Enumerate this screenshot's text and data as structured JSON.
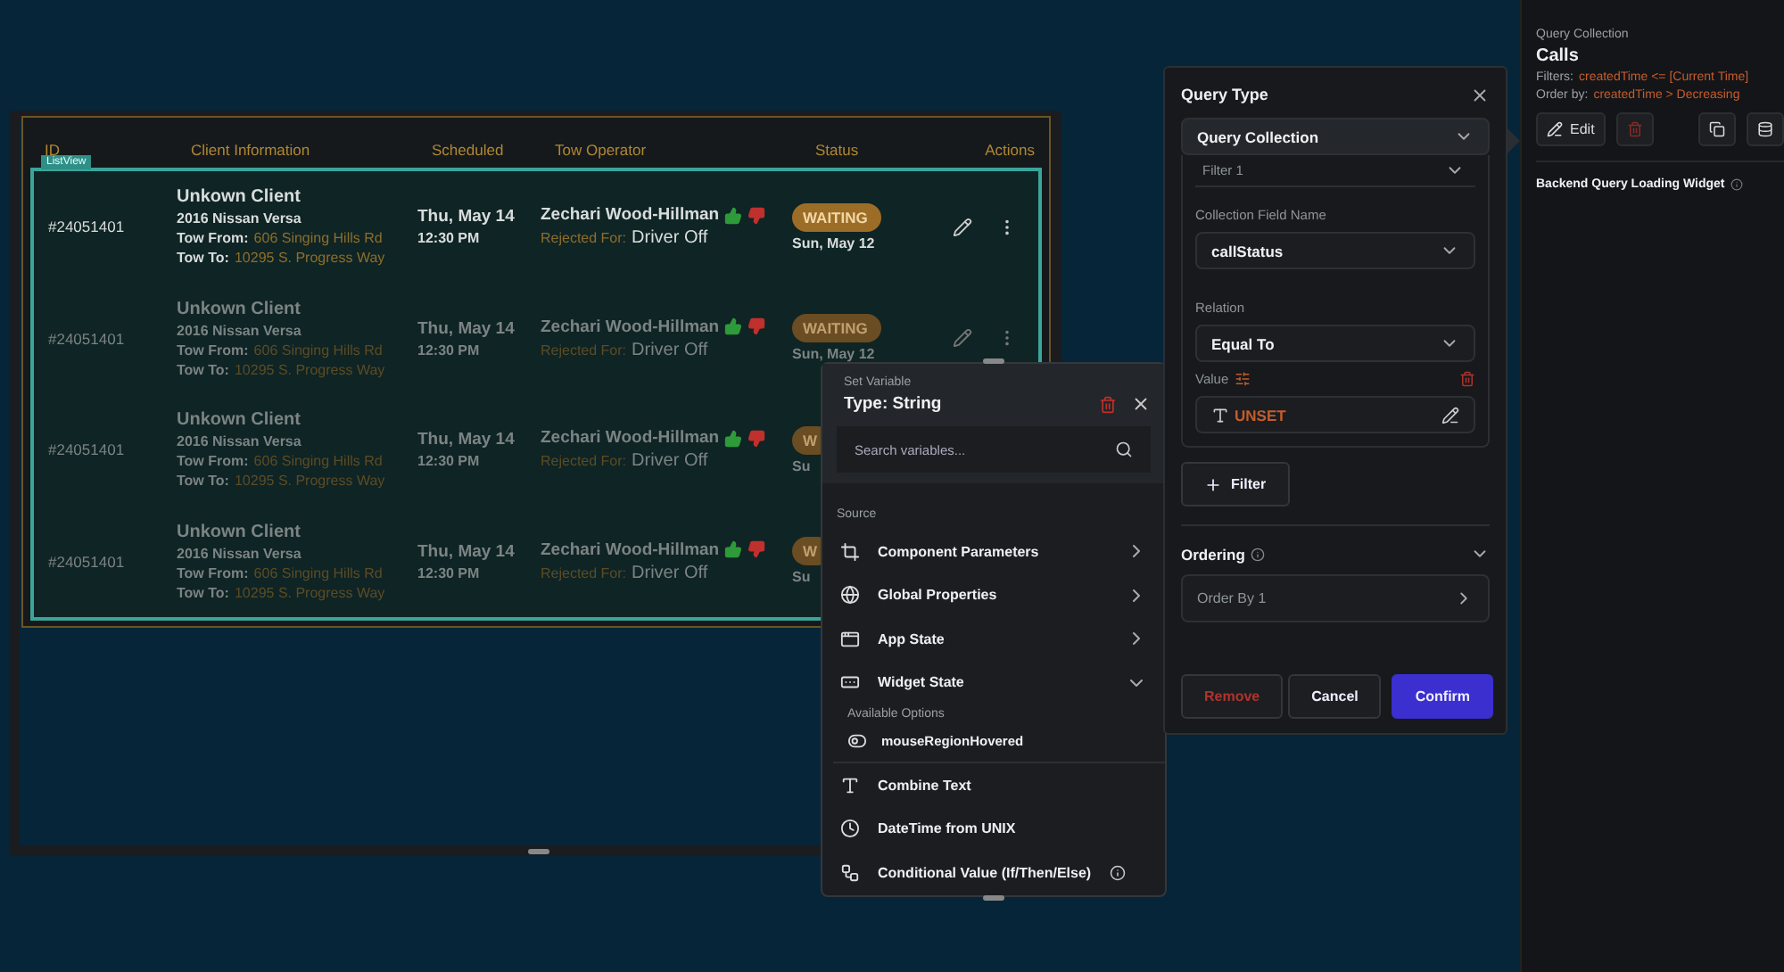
{
  "table": {
    "list_tag": "ListView",
    "columns": [
      "ID",
      "Client Information",
      "Scheduled",
      "Tow Operator",
      "Status",
      "Actions"
    ],
    "rows": [
      {
        "id": "#24051401",
        "client": "Unkown Client",
        "vehicle": "2016 Nissan Versa",
        "from_label": "Tow From:",
        "from": "606 Singing Hills Rd",
        "to_label": "Tow To:",
        "to": "10295 S. Progress Way",
        "date": "Thu, May 14",
        "time": "12:30 PM",
        "operator": "Zechari Wood-Hillman",
        "rejected_label": "Rejected For:",
        "reason": "Driver Off",
        "status": "WAITING",
        "status_date": "Sun, May 12",
        "dimmed": false,
        "covered": false
      },
      {
        "id": "#24051401",
        "client": "Unkown Client",
        "vehicle": "2016 Nissan Versa",
        "from_label": "Tow From:",
        "from": "606 Singing Hills Rd",
        "to_label": "Tow To:",
        "to": "10295 S. Progress Way",
        "date": "Thu, May 14",
        "time": "12:30 PM",
        "operator": "Zechari Wood-Hillman",
        "rejected_label": "Rejected For:",
        "reason": "Driver Off",
        "status": "WAITING",
        "status_date": "Sun, May 12",
        "dimmed": true,
        "covered": false
      },
      {
        "id": "#24051401",
        "client": "Unkown Client",
        "vehicle": "2016 Nissan Versa",
        "from_label": "Tow From:",
        "from": "606 Singing Hills Rd",
        "to_label": "Tow To:",
        "to": "10295 S. Progress Way",
        "date": "Thu, May 14",
        "time": "12:30 PM",
        "operator": "Zechari Wood-Hillman",
        "rejected_label": "Rejected For:",
        "reason": "Driver Off",
        "status": "W",
        "status_date": "Su",
        "dimmed": true,
        "covered": true
      },
      {
        "id": "#24051401",
        "client": "Unkown Client",
        "vehicle": "2016 Nissan Versa",
        "from_label": "Tow From:",
        "from": "606 Singing Hills Rd",
        "to_label": "Tow To:",
        "to": "10295 S. Progress Way",
        "date": "Thu, May 14",
        "time": "12:30 PM",
        "operator": "Zechari Wood-Hillman",
        "rejected_label": "Rejected For:",
        "reason": "Driver Off",
        "status": "W",
        "status_date": "Su",
        "dimmed": true,
        "covered": true
      }
    ]
  },
  "set_variable": {
    "caption": "Set Variable",
    "title": "Type: String",
    "search": {
      "placeholder": "Search variables..."
    },
    "section": "Source",
    "items": [
      {
        "label": "Component Parameters",
        "kind": "submenu",
        "info": false
      },
      {
        "label": "Global Properties",
        "kind": "submenu",
        "info": false
      },
      {
        "label": "App State",
        "kind": "submenu",
        "info": false
      },
      {
        "label": "Widget State",
        "kind": "expandable",
        "expanded": true,
        "info": false,
        "options_label": "Available Options",
        "options": [
          "mouseRegionHovered"
        ]
      },
      {
        "label": "Combine Text",
        "kind": "action",
        "info": false
      },
      {
        "label": "DateTime from UNIX",
        "kind": "action",
        "info": false
      },
      {
        "label": "Conditional Value (If/Then/Else)",
        "kind": "action",
        "info": true
      }
    ]
  },
  "query_panel": {
    "title": "Query Type",
    "query_type": "Query Collection",
    "filter_name": "Filter 1",
    "field_label": "Collection Field Name",
    "field_value": "callStatus",
    "relation_label": "Relation",
    "relation_value": "Equal To",
    "value_label": "Value",
    "value": "UNSET",
    "add_filter": "Filter",
    "ordering": "Ordering",
    "order_by": "Order By 1",
    "buttons": {
      "remove": "Remove",
      "cancel": "Cancel",
      "confirm": "Confirm"
    }
  },
  "sidebar": {
    "caption": "Query Collection",
    "title": "Calls",
    "filters_label": "Filters:",
    "filters": "createdTime <= [Current Time]",
    "order_label": "Order by:",
    "order": "createdTime > Decreasing",
    "edit": "Edit",
    "loading_widget": "Backend Query Loading Widget"
  }
}
